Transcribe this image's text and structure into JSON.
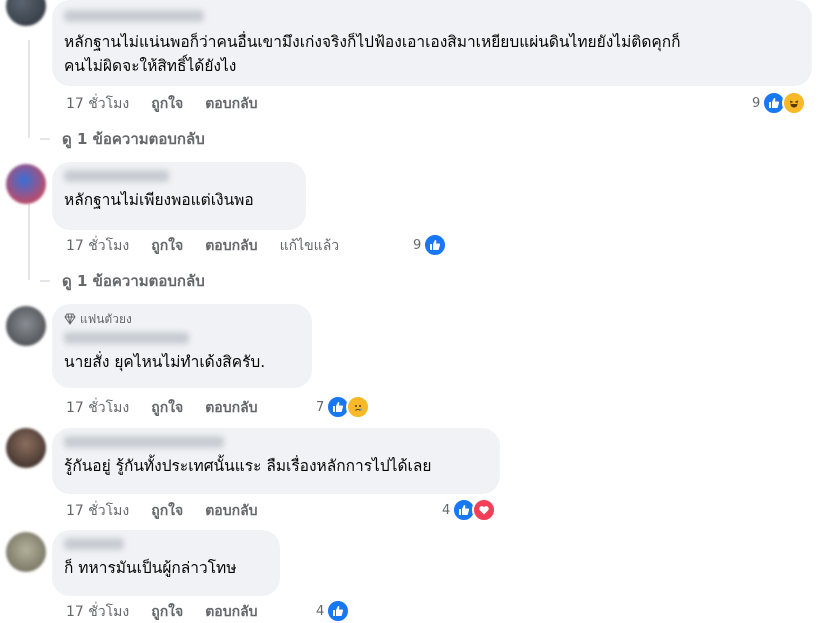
{
  "comments": [
    {
      "text_lines": [
        "หลักฐานไม่แน่นพอก็ว่าคนอื่นเขามึงเก่งจริงก็ไปฟ้องเอาเองสิมาเหยียบแผ่นดินไทยยังไม่ติดคุกก็",
        "คนไม่ผิดจะให้สิทธิ์ได้ยังไง"
      ],
      "time": "17 ชั่วโมง",
      "like": "ถูกใจ",
      "reply": "ตอบกลับ",
      "reaction_count": "9",
      "reactions": [
        "like-icon",
        "haha-icon"
      ]
    },
    {
      "text_lines": [
        "หลักฐานไม่เพียงพอแต่เงินพอ"
      ],
      "time": "17 ชั่วโมง",
      "like": "ถูกใจ",
      "reply": "ตอบกลับ",
      "edited": "แก้ไขแล้ว",
      "reaction_count": "9",
      "reactions": [
        "like-icon"
      ]
    },
    {
      "badge": "แฟนตัวยง",
      "text_lines": [
        "นายสั่ง ยุคไหนไม่ทำเด้งสิครับ."
      ],
      "time": "17 ชั่วโมง",
      "like": "ถูกใจ",
      "reply": "ตอบกลับ",
      "reaction_count": "7",
      "reactions": [
        "like-icon",
        "sad-icon"
      ]
    },
    {
      "text_lines": [
        "รู้กันอยู่ รู้กันทั้งประเทศนั้นแระ ลืมเรื่องหลักการไปได้เลย"
      ],
      "time": "17 ชั่วโมง",
      "like": "ถูกใจ",
      "reply": "ตอบกลับ",
      "reaction_count": "4",
      "reactions": [
        "like-icon",
        "love-icon"
      ]
    },
    {
      "text_lines": [
        "ก็ ทหารมันเป็นผู้กล่าวโทษ"
      ],
      "time": "17 ชั่วโมง",
      "like": "ถูกใจ",
      "reply": "ตอบกลับ",
      "reaction_count": "4",
      "reactions": [
        "like-icon"
      ]
    }
  ],
  "view_replies": [
    "ดู 1 ข้อความตอบกลับ",
    "ดู 1 ข้อความตอบกลับ"
  ],
  "colors": {
    "like": "#1877f2",
    "bubble": "#f0f2f5",
    "meta": "#65676b",
    "love": "#f33e58",
    "haha": "#f7b928"
  }
}
